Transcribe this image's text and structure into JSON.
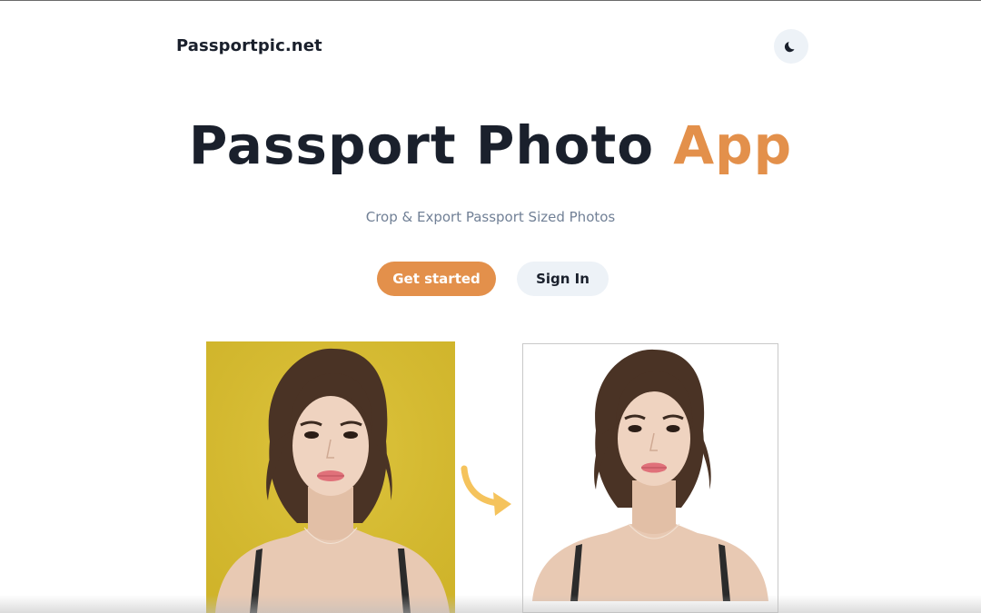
{
  "brand": {
    "name": "Passportpic.net"
  },
  "theme_toggle": {
    "icon": "moon-icon"
  },
  "hero": {
    "title_main": "Passport Photo ",
    "title_accent": "App",
    "subtitle": "Crop & Export Passport Sized Photos"
  },
  "actions": {
    "primary_label": "Get started",
    "secondary_label": "Sign In"
  },
  "showcase": {
    "before_icon": "portrait-yellow-background",
    "arrow_icon": "curved-arrow-icon",
    "after_icon": "portrait-white-background"
  },
  "colors": {
    "accent": "#e3904b",
    "text_dark": "#1a202c",
    "text_muted": "#718096",
    "button_light": "#edf2f7",
    "photo_background": "#d6bd33",
    "arrow": "#f5c35c"
  }
}
